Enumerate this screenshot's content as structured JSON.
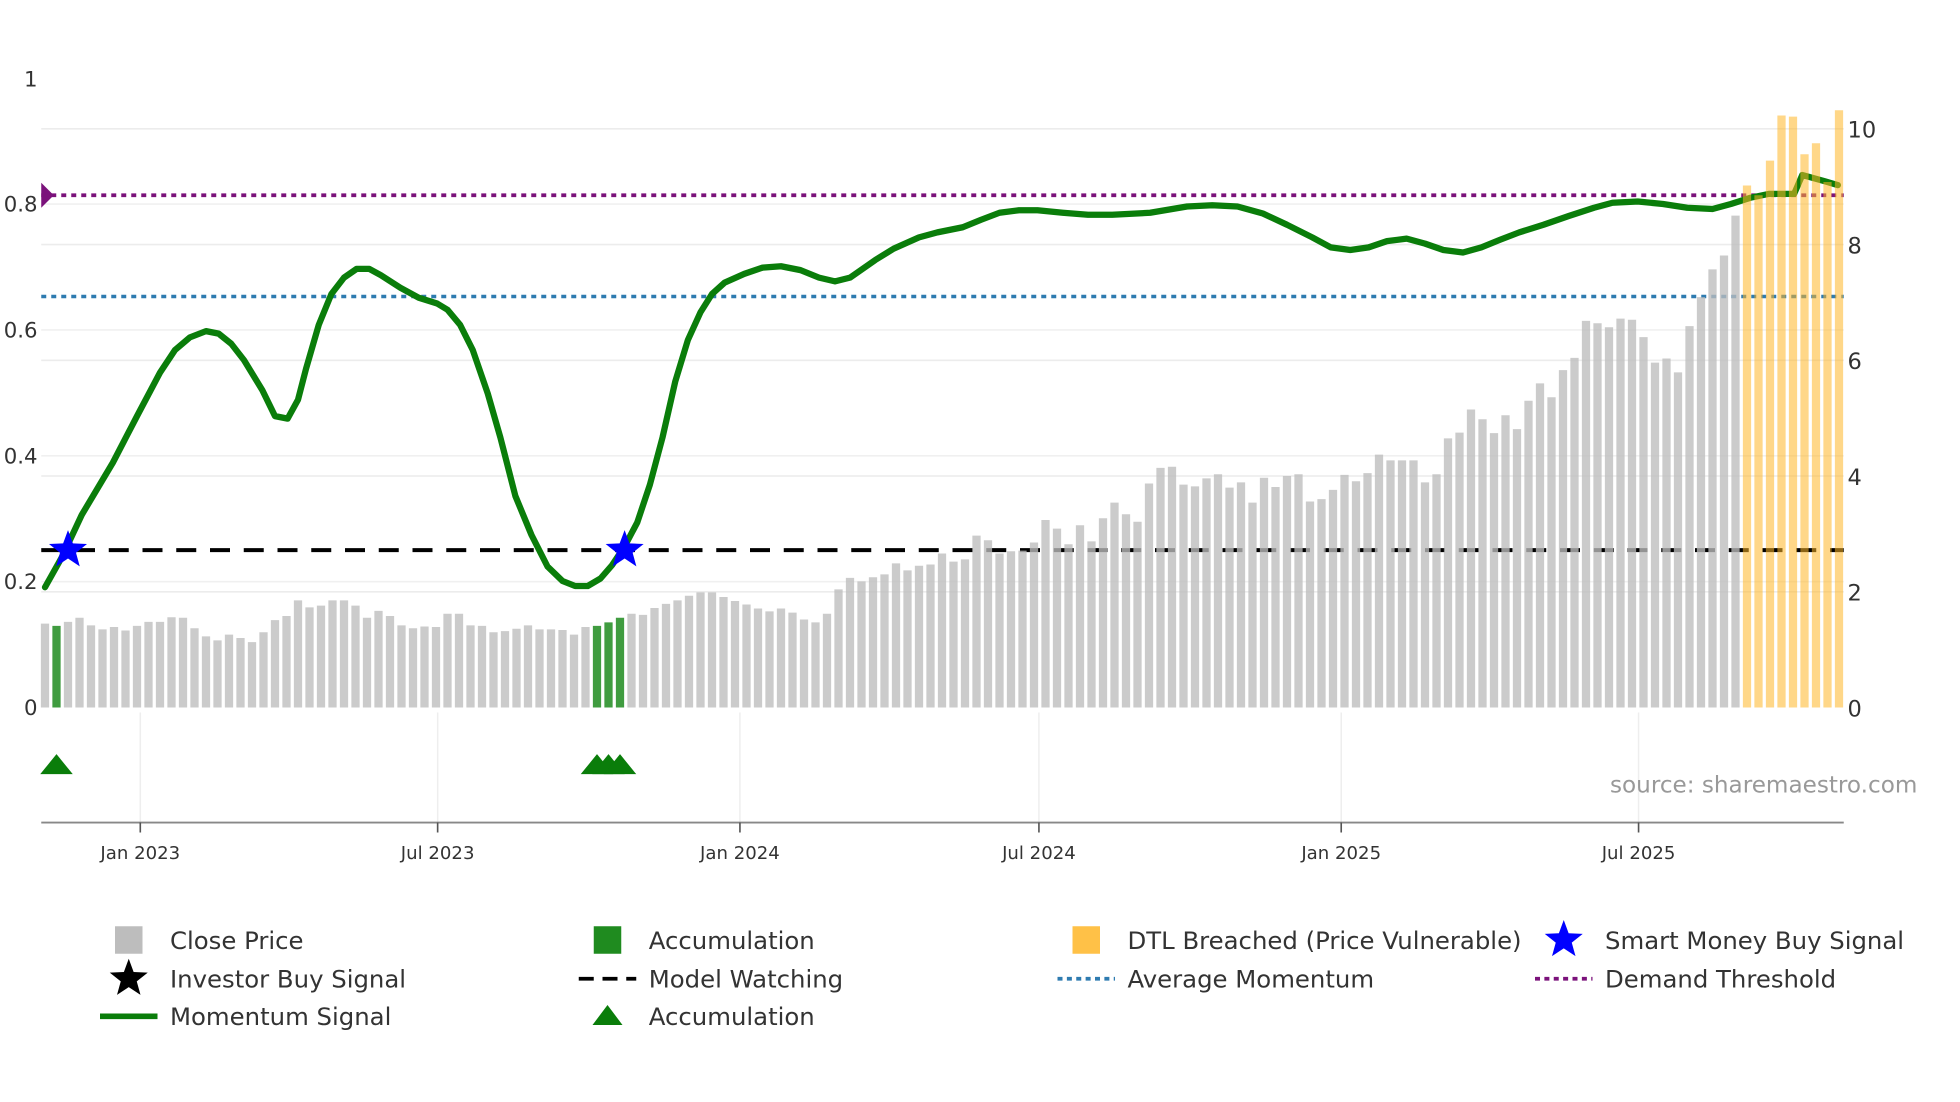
{
  "chart_data": {
    "type": "bar",
    "title": "",
    "source": "source: sharemaestro.com",
    "frequency": "weekly",
    "start_date": "2022-11-04",
    "x_ticks": [
      {
        "label": "Jan 2023",
        "date": "2023-01-01"
      },
      {
        "label": "Jul 2023",
        "date": "2023-07-01"
      },
      {
        "label": "Jan 2024",
        "date": "2024-01-01"
      },
      {
        "label": "Jul 2024",
        "date": "2024-07-01"
      },
      {
        "label": "Jan 2025",
        "date": "2025-01-01"
      },
      {
        "label": "Jul 2025",
        "date": "2025-07-01"
      }
    ],
    "y_left": {
      "ylim": [
        -0.18,
        1.0
      ],
      "ticks": [
        "0",
        "0.2",
        "0.4",
        "0.6",
        "0.8",
        "1"
      ],
      "tick_values": [
        0,
        0.2,
        0.4,
        0.6,
        0.8,
        1.0
      ]
    },
    "y_right": {
      "ylim": [
        0,
        10.5
      ],
      "ticks": [
        "0",
        "2",
        "4",
        "6",
        "8",
        "10"
      ],
      "tick_values": [
        0,
        2,
        4,
        6,
        8,
        10
      ]
    },
    "grid": true,
    "close_price": [
      1.45,
      1.41,
      1.48,
      1.55,
      1.42,
      1.35,
      1.39,
      1.33,
      1.41,
      1.48,
      1.48,
      1.56,
      1.55,
      1.37,
      1.23,
      1.16,
      1.26,
      1.2,
      1.13,
      1.3,
      1.51,
      1.58,
      1.85,
      1.73,
      1.76,
      1.85,
      1.85,
      1.76,
      1.55,
      1.67,
      1.58,
      1.42,
      1.37,
      1.4,
      1.39,
      1.62,
      1.62,
      1.42,
      1.41,
      1.3,
      1.32,
      1.36,
      1.42,
      1.35,
      1.35,
      1.34,
      1.26,
      1.39,
      1.41,
      1.47,
      1.55,
      1.62,
      1.6,
      1.72,
      1.79,
      1.85,
      1.93,
      1.99,
      1.99,
      1.91,
      1.84,
      1.78,
      1.71,
      1.66,
      1.71,
      1.64,
      1.52,
      1.47,
      1.62,
      2.04,
      2.24,
      2.18,
      2.25,
      2.3,
      2.49,
      2.37,
      2.45,
      2.47,
      2.66,
      2.52,
      2.56,
      2.97,
      2.89,
      2.66,
      2.7,
      2.71,
      2.85,
      3.24,
      3.09,
      2.82,
      3.15,
      2.87,
      3.27,
      3.54,
      3.34,
      3.21,
      3.87,
      4.14,
      4.16,
      3.85,
      3.82,
      3.96,
      4.03,
      3.8,
      3.89,
      3.54,
      3.97,
      3.81,
      4.0,
      4.03,
      3.56,
      3.6,
      3.76,
      4.02,
      3.91,
      4.05,
      4.37,
      4.27,
      4.27,
      4.27,
      3.89,
      4.03,
      4.65,
      4.75,
      5.15,
      4.98,
      4.74,
      5.05,
      4.81,
      5.3,
      5.6,
      5.36,
      5.83,
      6.04,
      6.68,
      6.64,
      6.57,
      6.72,
      6.7,
      6.4,
      5.96,
      6.03,
      5.79,
      6.59,
      7.09,
      7.57,
      7.81,
      8.5,
      9.02,
      8.85,
      9.45,
      10.23,
      10.21,
      9.56,
      9.75,
      9.08,
      10.32
    ],
    "accumulation_weeks": [
      1,
      48,
      49,
      50
    ],
    "dtl_breached_weeks": [
      148,
      149,
      150,
      151,
      152,
      153,
      154,
      155,
      156
    ],
    "momentum_signal": [
      [
        0,
        0.191
      ],
      [
        1.5,
        0.24
      ],
      [
        3.2,
        0.306
      ],
      [
        5.9,
        0.389
      ],
      [
        8.0,
        0.463
      ],
      [
        10.0,
        0.532
      ],
      [
        11.3,
        0.568
      ],
      [
        12.6,
        0.588
      ],
      [
        14.0,
        0.598
      ],
      [
        15.1,
        0.594
      ],
      [
        16.2,
        0.578
      ],
      [
        17.3,
        0.552
      ],
      [
        18.9,
        0.504
      ],
      [
        20.0,
        0.463
      ],
      [
        21.1,
        0.459
      ],
      [
        22.0,
        0.489
      ],
      [
        22.7,
        0.538
      ],
      [
        23.8,
        0.608
      ],
      [
        24.9,
        0.657
      ],
      [
        26.0,
        0.683
      ],
      [
        27.1,
        0.697
      ],
      [
        28.2,
        0.697
      ],
      [
        29.2,
        0.687
      ],
      [
        30.9,
        0.667
      ],
      [
        32.5,
        0.651
      ],
      [
        34.1,
        0.642
      ],
      [
        35.0,
        0.632
      ],
      [
        36.1,
        0.608
      ],
      [
        37.2,
        0.568
      ],
      [
        38.5,
        0.499
      ],
      [
        39.6,
        0.429
      ],
      [
        40.9,
        0.336
      ],
      [
        42.3,
        0.274
      ],
      [
        43.7,
        0.224
      ],
      [
        45.0,
        0.201
      ],
      [
        46.1,
        0.193
      ],
      [
        47.2,
        0.193
      ],
      [
        48.3,
        0.205
      ],
      [
        49.3,
        0.226
      ],
      [
        50.4,
        0.256
      ],
      [
        51.5,
        0.294
      ],
      [
        52.6,
        0.354
      ],
      [
        53.7,
        0.429
      ],
      [
        54.8,
        0.518
      ],
      [
        55.9,
        0.584
      ],
      [
        57.0,
        0.628
      ],
      [
        58.0,
        0.657
      ],
      [
        59.1,
        0.675
      ],
      [
        60.8,
        0.689
      ],
      [
        62.4,
        0.699
      ],
      [
        64.0,
        0.701
      ],
      [
        65.7,
        0.695
      ],
      [
        67.3,
        0.683
      ],
      [
        68.7,
        0.677
      ],
      [
        70.0,
        0.683
      ],
      [
        72.2,
        0.711
      ],
      [
        73.8,
        0.729
      ],
      [
        76.0,
        0.747
      ],
      [
        77.6,
        0.755
      ],
      [
        79.8,
        0.763
      ],
      [
        81.4,
        0.775
      ],
      [
        83.0,
        0.786
      ],
      [
        84.7,
        0.79
      ],
      [
        86.3,
        0.79
      ],
      [
        88.5,
        0.786
      ],
      [
        90.7,
        0.783
      ],
      [
        92.8,
        0.783
      ],
      [
        96.1,
        0.786
      ],
      [
        99.3,
        0.796
      ],
      [
        101.5,
        0.798
      ],
      [
        103.7,
        0.796
      ],
      [
        105.9,
        0.785
      ],
      [
        108.0,
        0.767
      ],
      [
        110.2,
        0.747
      ],
      [
        111.8,
        0.731
      ],
      [
        113.5,
        0.727
      ],
      [
        115.1,
        0.731
      ],
      [
        116.7,
        0.741
      ],
      [
        118.4,
        0.745
      ],
      [
        120.0,
        0.737
      ],
      [
        121.6,
        0.727
      ],
      [
        123.3,
        0.723
      ],
      [
        124.9,
        0.731
      ],
      [
        126.5,
        0.743
      ],
      [
        128.2,
        0.755
      ],
      [
        130.3,
        0.767
      ],
      [
        132.5,
        0.781
      ],
      [
        134.7,
        0.794
      ],
      [
        136.3,
        0.802
      ],
      [
        138.5,
        0.804
      ],
      [
        140.7,
        0.8
      ],
      [
        142.8,
        0.794
      ],
      [
        145.0,
        0.792
      ],
      [
        146.6,
        0.8
      ],
      [
        148.3,
        0.81
      ],
      [
        149.9,
        0.816
      ],
      [
        152.1,
        0.816
      ],
      [
        152.8,
        0.846
      ],
      [
        154.8,
        0.836
      ],
      [
        155.9,
        0.83
      ]
    ],
    "demand_threshold": 0.814,
    "average_momentum": 0.653,
    "model_watching": 0.25,
    "smart_money_buy_signals": [
      [
        2,
        0.25
      ],
      [
        50.4,
        0.25
      ]
    ],
    "accumulation_markers": [
      [
        1,
        -0.09
      ],
      [
        48,
        -0.09
      ],
      [
        49,
        -0.09
      ],
      [
        50,
        -0.09
      ]
    ],
    "colors": {
      "close_price": "#bdbdbd",
      "accumulation": "#1f8b1f",
      "dtl": "#ffb627",
      "momentum": "#0a7d0a",
      "star": "#0000ff",
      "model_watching": "#000000",
      "average_momentum": "#2e7bb0",
      "demand_threshold": "#7b127b"
    },
    "legend": {
      "placement": "bottom",
      "items": [
        {
          "label": "Close Price",
          "kind": "square",
          "color": "#bdbdbd"
        },
        {
          "label": "Accumulation",
          "kind": "square",
          "color": "#1f8b1f"
        },
        {
          "label": "DTL Breached (Price Vulnerable)",
          "kind": "square",
          "color": "#ffb627"
        },
        {
          "label": "Smart Money Buy Signal",
          "kind": "star",
          "color": "#0000ff"
        },
        {
          "label": "Investor Buy Signal",
          "kind": "star",
          "color": "#000000"
        },
        {
          "label": "Model Watching",
          "kind": "dash",
          "color": "#000000"
        },
        {
          "label": "Average Momentum",
          "kind": "dot",
          "color": "#2e7bb0"
        },
        {
          "label": "Demand Threshold",
          "kind": "dot",
          "color": "#7b127b"
        },
        {
          "label": "Momentum Signal",
          "kind": "line",
          "color": "#0a7d0a"
        },
        {
          "label": "Accumulation",
          "kind": "triangle",
          "color": "#0a7d0a"
        }
      ]
    }
  }
}
